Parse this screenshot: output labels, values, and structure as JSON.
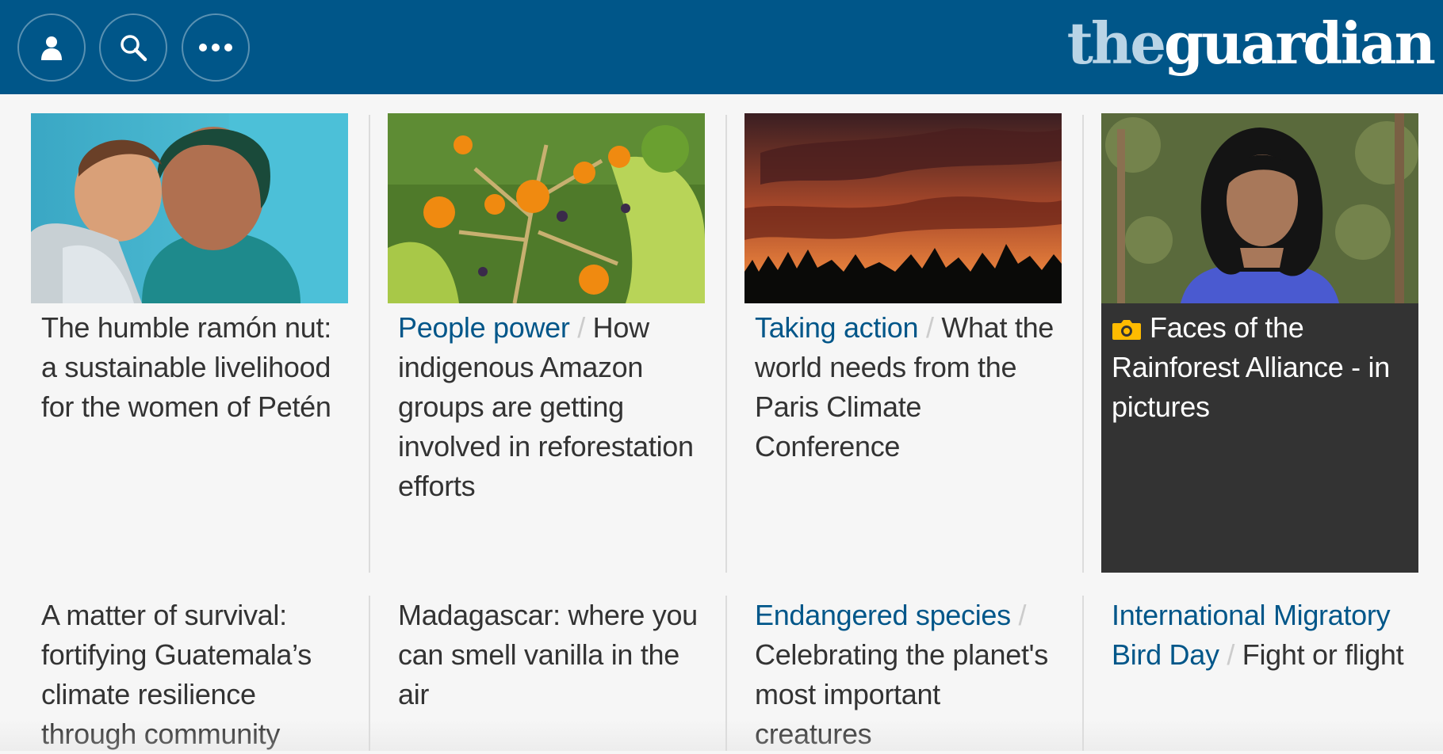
{
  "header": {
    "background": "#005689",
    "logo_the": "the",
    "logo_guardian": "guardian",
    "buttons": [
      {
        "icon": "user-icon"
      },
      {
        "icon": "search-icon"
      },
      {
        "icon": "more-icon"
      }
    ]
  },
  "top_row": [
    {
      "kicker": "",
      "title": "The humble ramón nut: a sustainable livelihood for the women of Petén"
    },
    {
      "kicker": "People power",
      "title": "How indigenous Amazon groups are getting involved in reforestation efforts"
    },
    {
      "kicker": "Taking action",
      "title": "What the world needs from the Paris Climate Conference"
    },
    {
      "kicker": "",
      "title": "Faces of the Rainforest Alliance - in pictures",
      "icon": "camera-icon"
    }
  ],
  "bottom_row": [
    {
      "kicker": "",
      "title": "A matter of survival: fortifying Guatemala’s climate resilience through community"
    },
    {
      "kicker": "",
      "title": "Madagascar: where you can smell vanilla in the air"
    },
    {
      "kicker": "Endangered species",
      "title": "Celebrating the planet's most important creatures"
    },
    {
      "kicker": "International Migratory Bird Day",
      "title": "Fight or flight"
    }
  ],
  "colors": {
    "kicker": "#005689",
    "text": "#333333",
    "gallery_bg": "#333333",
    "camera": "#ffbb00"
  }
}
